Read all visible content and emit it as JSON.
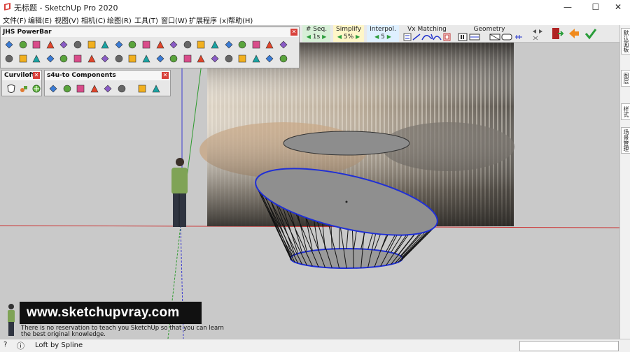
{
  "window": {
    "title": "无标题 - SketchUp Pro 2020",
    "min": "—",
    "max": "☐",
    "close": "✕"
  },
  "menu": [
    "文件(F)",
    "编辑(E)",
    "视图(V)",
    "相机(C)",
    "绘图(R)",
    "工具(T)",
    "窗口(W)",
    "扩展程序 (x)",
    "帮助(H)"
  ],
  "toolbar": {
    "seq": {
      "title": "# Seq.",
      "value": "1s"
    },
    "simplify": {
      "title": "Simplify",
      "value": "5%"
    },
    "interpol": {
      "title": "Interpol.",
      "value": "5"
    },
    "vx": {
      "title": "Vx Matching"
    },
    "geometry": {
      "title": "Geometry"
    }
  },
  "palettes": {
    "powerbar": {
      "title": "JHS PowerBar",
      "close": "✕"
    },
    "curviloft": {
      "title": "Curviloft",
      "close": "✕"
    },
    "s4u": {
      "title": "s4u-to Components",
      "close": "✕"
    }
  },
  "dock_tabs": [
    "默认面板",
    "图层",
    "样式",
    "场景管理"
  ],
  "banner": {
    "url": "www.sketchupvray.com",
    "line1": "There is no reservation to teach you SketchUp so that you can learn",
    "line2": "the best original knowledge."
  },
  "status": {
    "text": "Loft by Spline",
    "info": "ⓘ",
    "help": "?"
  },
  "colors": {
    "accent_red": "#d8403a",
    "exit_green": "#2a9d3a",
    "loft_blue": "#1f2fd6"
  }
}
